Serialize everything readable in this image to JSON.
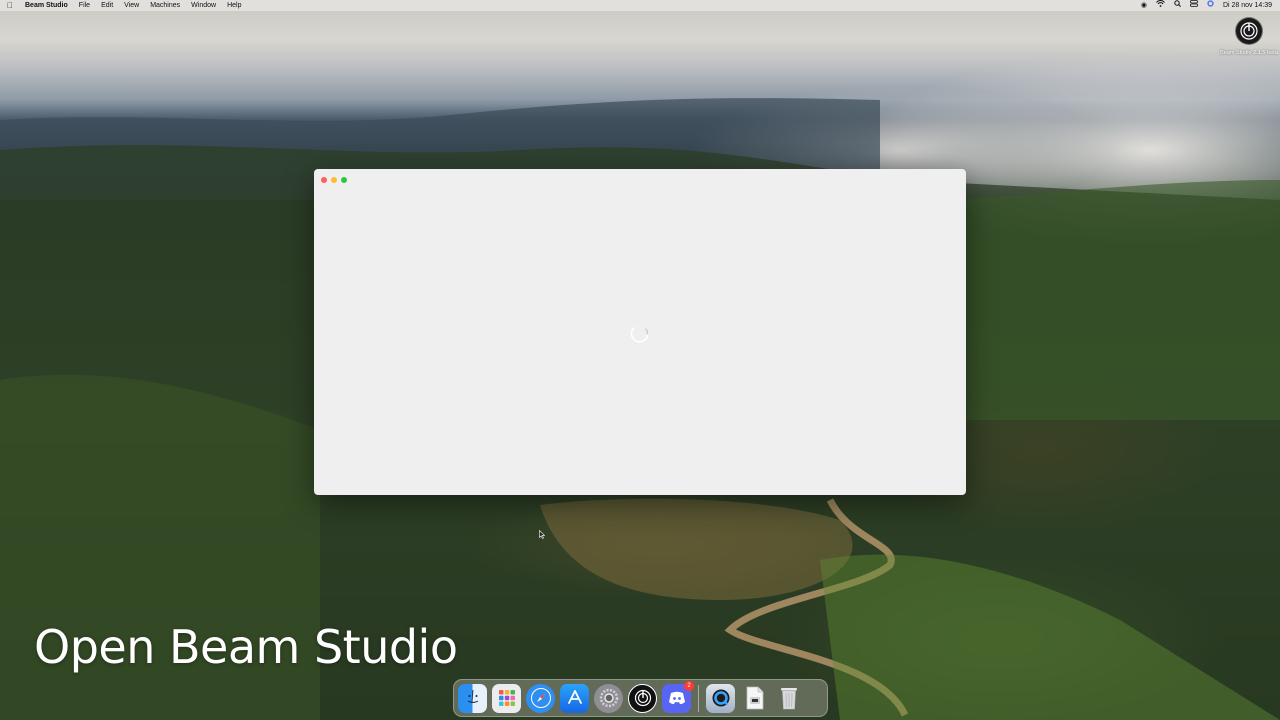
{
  "menubar": {
    "apple_icon": "apple-icon",
    "app_name": "Beam Studio",
    "menus": [
      "File",
      "Edit",
      "View",
      "Machines",
      "Window",
      "Help"
    ],
    "status_icons": [
      "record-icon",
      "wifi-icon",
      "search-icon",
      "control-center-icon",
      "siri-icon"
    ],
    "clock": "Di 28 nov  14:39"
  },
  "desktop": {
    "icon_label": "Beam Studio 2.1.5-beta"
  },
  "window": {
    "state": "loading",
    "spinner_icon": "spinner-icon"
  },
  "caption": "Open Beam Studio",
  "dock": {
    "items": [
      {
        "name": "Finder",
        "icon": "finder-icon",
        "color": "#3aa0f5"
      },
      {
        "name": "Launchpad",
        "icon": "launchpad-icon",
        "color": "#e9e9ec"
      },
      {
        "name": "Safari",
        "icon": "safari-icon",
        "color": "#2e8ff0"
      },
      {
        "name": "App Store",
        "icon": "app-store-icon",
        "color": "#1e7cf2"
      },
      {
        "name": "System Settings",
        "icon": "settings-icon",
        "color": "#8a8a8e"
      },
      {
        "name": "Beam Studio",
        "icon": "beam-studio-icon",
        "color": "#1a1a1a"
      },
      {
        "name": "Discord",
        "icon": "discord-icon",
        "color": "#5865f2",
        "badge": "2"
      },
      {
        "name": "QuickTime Player",
        "icon": "quicktime-icon",
        "color": "#1c6fd1"
      },
      {
        "name": "Documents",
        "icon": "document-icon",
        "color": "#f4f4f4"
      },
      {
        "name": "Trash",
        "icon": "trash-icon",
        "color": "#d6d8dc"
      }
    ]
  }
}
